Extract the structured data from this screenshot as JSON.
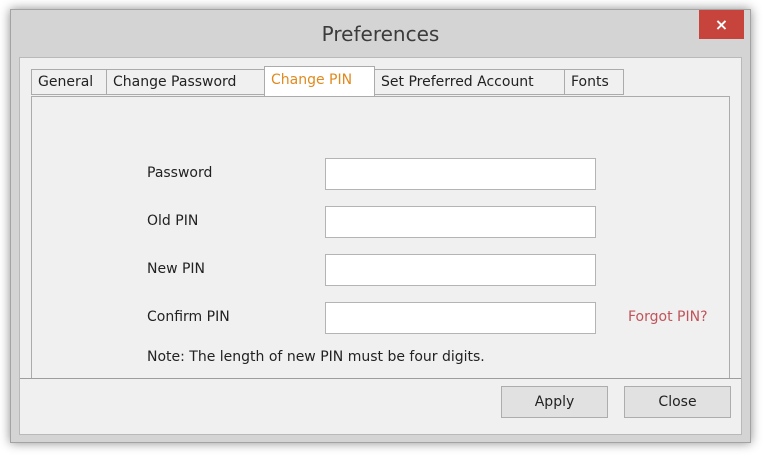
{
  "window": {
    "title": "Preferences",
    "close_glyph": "×"
  },
  "tabs": [
    {
      "label": "General",
      "active": false
    },
    {
      "label": "Change Password",
      "active": false
    },
    {
      "label": "Change PIN",
      "active": true
    },
    {
      "label": "Set Preferred Account",
      "active": false
    },
    {
      "label": "Fonts",
      "active": false
    }
  ],
  "form": {
    "password_label": "Password",
    "password_value": "",
    "old_pin_label": "Old PIN",
    "old_pin_value": "",
    "new_pin_label": "New PIN",
    "new_pin_value": "",
    "confirm_pin_label": "Confirm PIN",
    "confirm_pin_value": "",
    "forgot_link": "Forgot PIN?",
    "note": "Note: The length of new PIN must be four digits."
  },
  "buttons": {
    "apply_label": "Apply",
    "close_label": "Close"
  },
  "colors": {
    "active_tab_text": "#e08a1e",
    "link_text": "#c0545a",
    "close_button": "#c7443c"
  }
}
